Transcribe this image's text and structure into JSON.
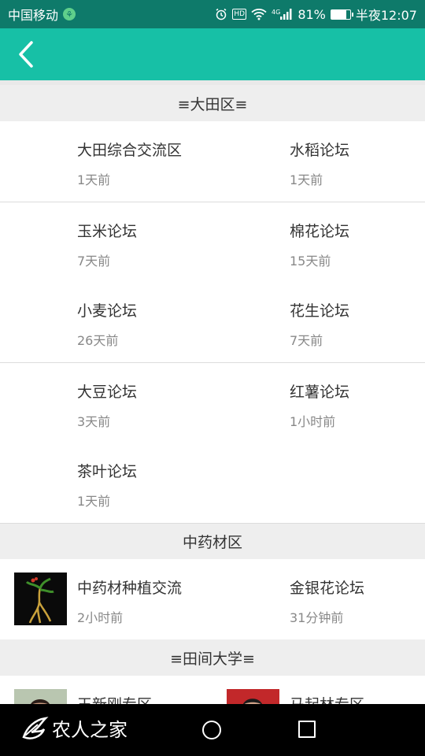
{
  "status_bar": {
    "carrier": "中国移动",
    "hd_label": "HD",
    "network_label": "4G",
    "battery": "81%",
    "battery_level": 0.81,
    "time": "半夜12:07"
  },
  "sections": {
    "datian": {
      "title": "≡大田区≡",
      "rows": [
        [
          {
            "title": "大田综合交流区",
            "time": "1天前"
          },
          {
            "title": "水稻论坛",
            "time": "1天前"
          }
        ],
        [
          {
            "title": "玉米论坛",
            "time": "7天前"
          },
          {
            "title": "棉花论坛",
            "time": "15天前"
          }
        ],
        [
          {
            "title": "小麦论坛",
            "time": "26天前"
          },
          {
            "title": "花生论坛",
            "time": "7天前"
          }
        ],
        [
          {
            "title": "大豆论坛",
            "time": "3天前"
          },
          {
            "title": "红薯论坛",
            "time": "1小时前"
          }
        ],
        [
          {
            "title": "茶叶论坛",
            "time": "1天前"
          }
        ]
      ]
    },
    "zhongyao": {
      "title": "中药材区",
      "rows": [
        [
          {
            "title": "中药材种植交流",
            "time": "2小时前"
          },
          {
            "title": "金银花论坛",
            "time": "31分钟前"
          }
        ]
      ]
    },
    "tianjian": {
      "title": "≡田间大学≡",
      "rows": [
        [
          {
            "title": "王新刚专区"
          },
          {
            "title": "马起林专区"
          }
        ]
      ]
    }
  },
  "nav_bar": {
    "logo_text": "农人之家"
  },
  "icons": {
    "back": "chevron-left-icon",
    "home": "circle-home-icon",
    "recent": "square-recent-icon"
  },
  "colors": {
    "status_bar": "#0e7a6a",
    "app_bar": "#17c0a6"
  }
}
